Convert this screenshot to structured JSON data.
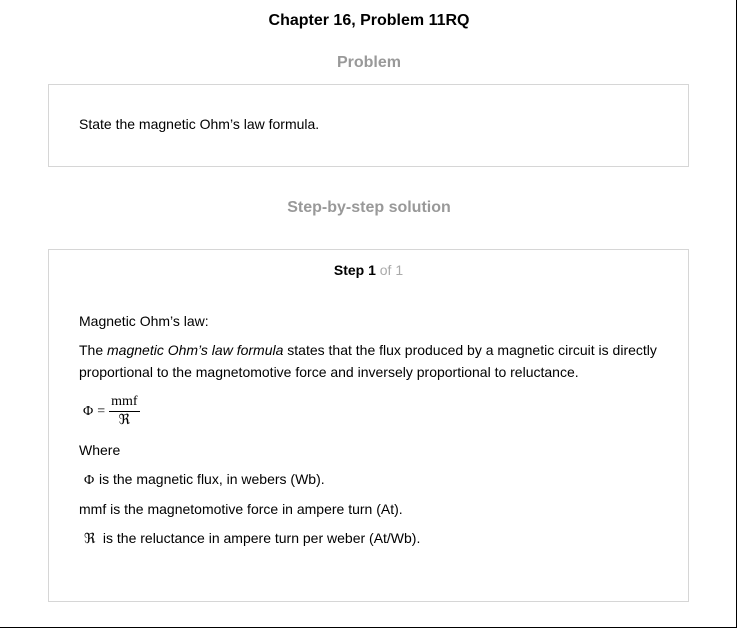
{
  "page_title": "Chapter 16, Problem 11RQ",
  "problem": {
    "heading": "Problem",
    "text": "State the magnetic Ohm’s law formula."
  },
  "solution": {
    "heading": "Step-by-step solution",
    "step_label": "Step 1",
    "step_of": "of 1",
    "intro": "Magnetic Ohm’s law:",
    "para_prefix": "The ",
    "para_italic": "magnetic Ohm’s law formula",
    "para_rest": " states that the flux produced by a magnetic circuit is directly proportional to the magnetomotive force and inversely proportional to reluctance.",
    "formula": {
      "lhs": "Φ",
      "equals": "=",
      "numerator": "mmf",
      "denominator": "ℜ"
    },
    "where": "Where",
    "defs": [
      {
        "symbol": "Φ",
        "text": "is the magnetic flux, in webers (Wb)."
      },
      {
        "symbol": "",
        "text": "mmf is the magnetomotive force in ampere turn (At)."
      },
      {
        "symbol": "ℜ",
        "text": " is the reluctance in ampere turn per weber (At/Wb)."
      }
    ]
  }
}
